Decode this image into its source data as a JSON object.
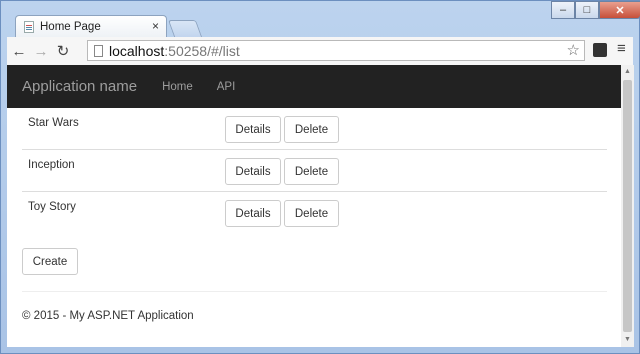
{
  "browser": {
    "tab_title": "Home Page",
    "tab_close": "×",
    "url_host": "localhost",
    "url_rest": ":50258/#/list",
    "back": "←",
    "forward": "→",
    "reload": "↻",
    "star": "☆",
    "menu": "≡",
    "win_min": "–",
    "win_max": "□",
    "win_close": "✕"
  },
  "navbar": {
    "brand": "Application name",
    "links": [
      "Home",
      "API"
    ]
  },
  "movies": [
    {
      "title": "Star Wars"
    },
    {
      "title": "Inception"
    },
    {
      "title": "Toy Story"
    }
  ],
  "buttons": {
    "details": "Details",
    "delete": "Delete",
    "create": "Create"
  },
  "footer": "© 2015 - My ASP.NET Application",
  "colors": {
    "navbar_bg": "#222222",
    "navbar_text": "#9d9d9d"
  }
}
